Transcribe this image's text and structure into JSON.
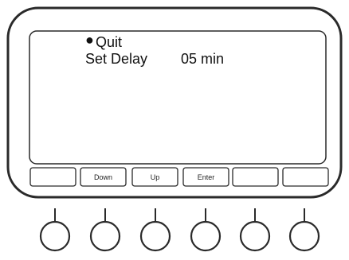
{
  "display": {
    "lines": [
      {
        "bullet": "●",
        "text": "Quit"
      },
      {
        "text": "Set Delay"
      }
    ],
    "delay_value": "05 min"
  },
  "softkeys": [
    "",
    "Down",
    "Up",
    "Enter",
    "",
    ""
  ],
  "button_names": [
    "softkey-1-button",
    "softkey-down-button",
    "softkey-up-button",
    "softkey-enter-button",
    "softkey-5-button",
    "softkey-6-button"
  ]
}
